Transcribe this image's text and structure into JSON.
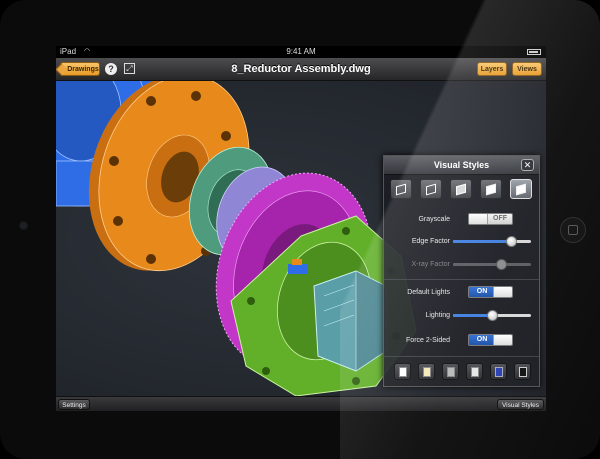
{
  "status_bar": {
    "carrier": "iPad",
    "time": "9:41 AM"
  },
  "nav_bar": {
    "back_button": "Drawings",
    "help_icon": "help-icon",
    "fullscreen_icon": "fullscreen-icon",
    "title": "8_Reductor Assembly.dwg",
    "layers_button": "Layers",
    "views_button": "Views"
  },
  "bottom_bar": {
    "settings_button": "Settings",
    "visual_styles_button": "Visual Styles"
  },
  "visual_styles_panel": {
    "title": "Visual Styles",
    "close_glyph": "✕",
    "styles": [
      "2d-wireframe-icon",
      "3d-wireframe-icon",
      "hidden-icon",
      "realistic-icon",
      "conceptual-icon"
    ],
    "grayscale": {
      "label": "Grayscale",
      "state": "OFF"
    },
    "edge_factor": {
      "label": "Edge Factor",
      "value": 0.75
    },
    "xray_factor": {
      "label": "X-ray Factor",
      "value": 0.62,
      "enabled": false
    },
    "default_lights": {
      "label": "Default Lights",
      "state": "ON"
    },
    "lighting": {
      "label": "Lighting",
      "value": 0.5
    },
    "force_2sided": {
      "label": "Force 2-Sided",
      "state": "ON"
    },
    "backgrounds": [
      "white-page-icon",
      "paper-page-icon",
      "grey-page-icon",
      "light-page-icon",
      "blue-page-icon",
      "black-page-icon"
    ]
  },
  "colors": {
    "gear_orange": "#e8891c",
    "gear_magenta": "#c236c8",
    "gear_green": "#62b02a",
    "housing_blue": "#2f6de6",
    "teal": "#5a9ea8",
    "accent_blue": "#2d6fd6",
    "button_orange": "#eba53e"
  }
}
